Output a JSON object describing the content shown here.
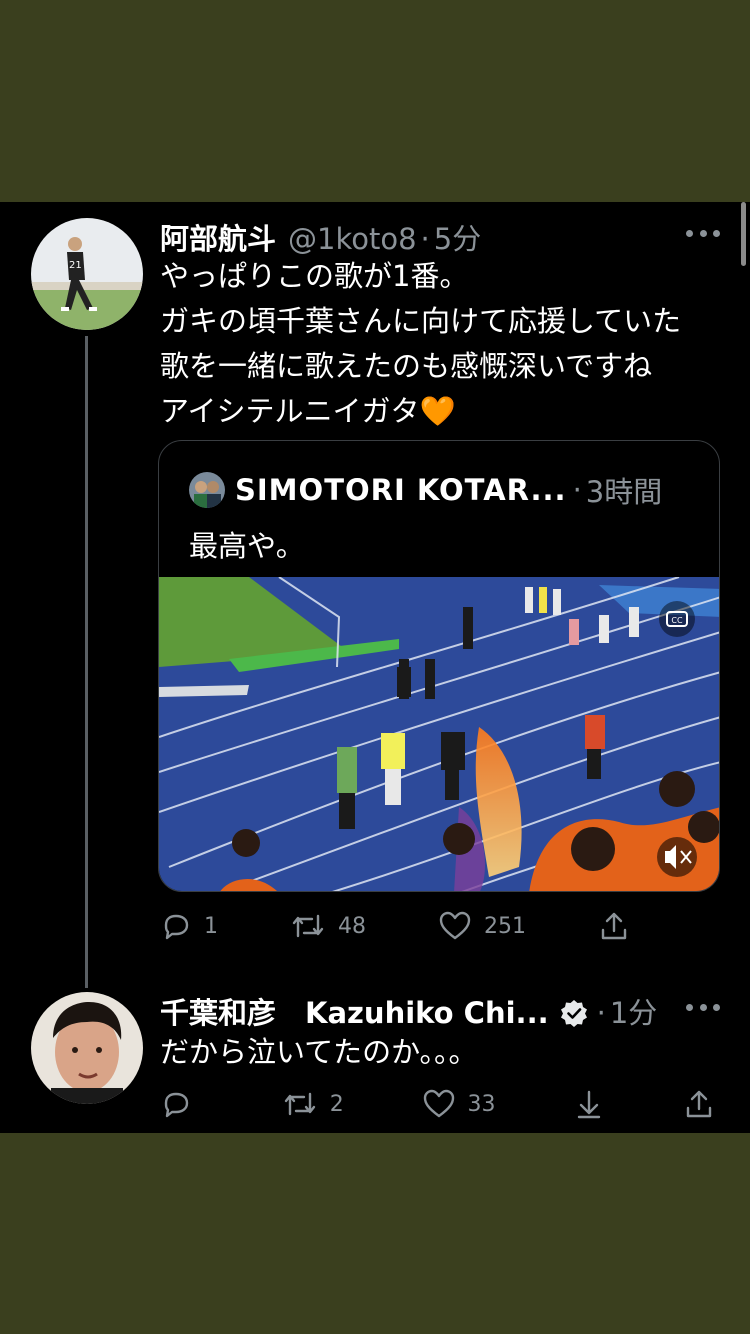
{
  "tweet1": {
    "name": "阿部航斗",
    "handle": "@1koto8",
    "separator": "·",
    "time": "5分",
    "text": "やっぱりこの歌が1番。\nガキの頃千葉さんに向けて応援していた\n歌を一緒に歌えたのも感慨深いですね\nアイシテルニイガタ🧡",
    "quote": {
      "name": "SIMOTORI KOTAR...",
      "separator": "·",
      "time": "3時間",
      "text": "最高や。"
    },
    "stats": {
      "replies": "1",
      "retweets": "48",
      "likes": "251"
    }
  },
  "tweet2": {
    "name": "千葉和彦　Kazuhiko Chi...",
    "separator": "·",
    "time": "1分",
    "text": "だから泣いてたのか。。。",
    "stats": {
      "replies": "",
      "retweets": "2",
      "likes": "33"
    }
  },
  "icons": {
    "reply": "reply-icon",
    "retweet": "retweet-icon",
    "like": "heart-icon",
    "share": "share-icon",
    "download": "download-icon",
    "more": "more-icon",
    "verified": "verified-icon",
    "captions": "captions-icon",
    "mute": "mute-icon"
  },
  "colors": {
    "background": "#000000",
    "outer": "#3a3f1e",
    "muted": "#8b9298",
    "track": "#2d4a9a",
    "field": "#5e9a3a"
  }
}
